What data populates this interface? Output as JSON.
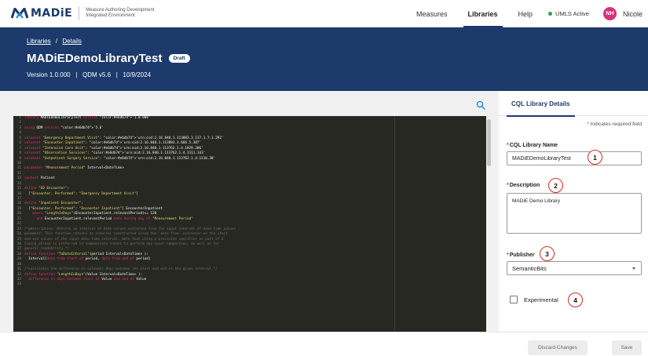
{
  "nav": {
    "logo_text": "MADiE",
    "logo_subtitle_line1": "Measure Authoring Development",
    "logo_subtitle_line2": "Integrated Environment",
    "links": [
      "Measures",
      "Libraries",
      "Help"
    ],
    "active_link": "Libraries",
    "umls_status": "UMLS Active",
    "user_initials": "NH",
    "user_name": "Nicole"
  },
  "header": {
    "breadcrumb_libraries": "Libraries",
    "breadcrumb_separator": "/",
    "breadcrumb_details": "Details",
    "title": "MADiEDemoLibraryTest",
    "status_badge": "Draft",
    "meta": "Version 1.0.000   |   QDM v5.6   |   10/9/2024"
  },
  "editor": {
    "lines": [
      "library MADiEDemoLibraryTest version '1.0.000'",
      "",
      "using QDM version '5.6'",
      "",
      "valueset \"Emergency Department Visit\": 'urn:oid:2.16.840.1.113883.3.117.1.7.1.292'",
      "valueset \"Encounter Inpatient\": 'urn:oid:2.16.840.1.113883.3.666.5.307'",
      "valueset \"Intensive Care Unit\": 'urn:oid:2.16.840.1.113762.1.4.1029.206'",
      "valueset \"Observation Services\": 'urn:oid:2.16.840.1.113762.1.4.1111.143'",
      "valueset \"Outpatient Surgery Service\": 'urn:oid:2.16.840.1.113762.1.4.1110.38'",
      "",
      "parameter \"Measurement Period\" Interval<DateTime>",
      "",
      "context Patient",
      "",
      "define \"ED Encounter\":",
      "  [\"Encounter, Performed\": \"Emergency Department Visit\"]",
      "",
      "define \"Inpatient Encounter\":",
      "  [\"Encounter, Performed\": \"Encounter Inpatient\"] EncounterInpatient",
      "    where \"LengthInDays\"(EncounterInpatient.relevantPeriod)<= 120",
      "      and EncounterInpatient.relevantPeriod ends during day of \"Measurement Period\"",
      "",
      "/*@description: Returns an interval of date values extracted from the input interval of date-time values",
      "@comment: This function returns an interval constructed using the `date from` extractor on the start",
      "and end values of the input date-time interval. Note that using a precision specifier as part of a",
      "timing phrase is preferred to communicate intent to perform day-level comparison, as well as for",
      "general readability.*/",
      "define function \"ToDateInterval\"(period Interval<DateTime> ):",
      "  Interval[date from start of period, date from end of period]",
      "",
      "/*calculates the difference in calendar days between the start and end of the given interval.*/",
      "define function \"LengthInDays\"(Value Interval<DateTime> ):",
      "  difference in days between start of Value and end of Value",
      ""
    ]
  },
  "panel": {
    "tab_label": "CQL Library Details",
    "required_note": "Indicates required field",
    "required_marker": "*",
    "name_label": "CQL Library Name",
    "name_value": "MADiEDemoLibraryTest",
    "description_label": "Description",
    "description_value": "MADiE Demo Library",
    "publisher_label": "Publisher",
    "publisher_value": "SemanticBits",
    "experimental_label": "Experimental",
    "callouts": [
      "1",
      "2",
      "3",
      "4"
    ]
  },
  "footer": {
    "discard_label": "Discard Changes",
    "save_label": "Save"
  },
  "colors": {
    "brand_navy": "#1c3a6c",
    "editor_bg": "#272822",
    "avatar_pink": "#d6337a",
    "umls_green": "#2e9e4b",
    "callout_red": "#d22b1e"
  }
}
